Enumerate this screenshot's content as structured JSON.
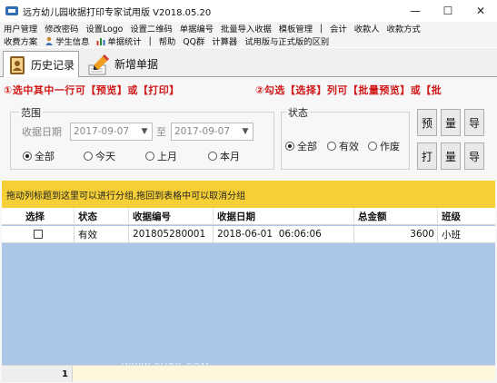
{
  "window": {
    "title": "远方幼儿园收据打印专家试用版 V2018.05.20",
    "min": "—",
    "max": "☐",
    "close": "✕"
  },
  "menu_row1": [
    "用户管理",
    "修改密码",
    "设置Logo",
    "设置二维码",
    "单据编号",
    "批量导入收据",
    "模板管理",
    "|",
    "会计",
    "收款人",
    "收款方式"
  ],
  "menu_row2": [
    "收费方案",
    "学生信息",
    "单据统计",
    "|",
    "帮助",
    "QQ群",
    "计算器",
    "试用版与正式版的区别"
  ],
  "tabs": {
    "history": "历史记录",
    "new_receipt": "新增单据"
  },
  "hints": {
    "left": "①选中其中一行可【预览】或【打印】",
    "right": "②勾选【选择】列可【批量预览】或【批"
  },
  "range": {
    "legend": "范围",
    "date_label": "收据日期",
    "date_from": "2017-09-07",
    "to_label": "至",
    "date_to": "2017-09-07",
    "options": [
      "全部",
      "今天",
      "上月",
      "本月"
    ],
    "selected": "全部"
  },
  "status": {
    "legend": "状态",
    "options": [
      "全部",
      "有效",
      "作废"
    ],
    "selected": "全部"
  },
  "side_buttons": {
    "b1": "预",
    "b2": "量",
    "b3": "导",
    "b4": "打",
    "b5": "量",
    "b6": "导"
  },
  "group_hint": "拖动列标题到这里可以进行分组,拖回到表格中可以取消分组",
  "table": {
    "columns": [
      "选择",
      "状态",
      "收据编号",
      "收据日期",
      "总金额",
      "班级"
    ],
    "rows": [
      {
        "status": "有效",
        "number": "201805280001",
        "date": "2018-06-01  06:06:06",
        "amount": "3600",
        "class": "小班"
      }
    ]
  },
  "footer": {
    "count": "1"
  },
  "watermark": "WWW.9UPK.COM",
  "colors": {
    "accent_red": "#d01818",
    "group_bar": "#f6cf36",
    "grid_bg": "#abc6e7",
    "footer_bg": "#fff7dd"
  }
}
